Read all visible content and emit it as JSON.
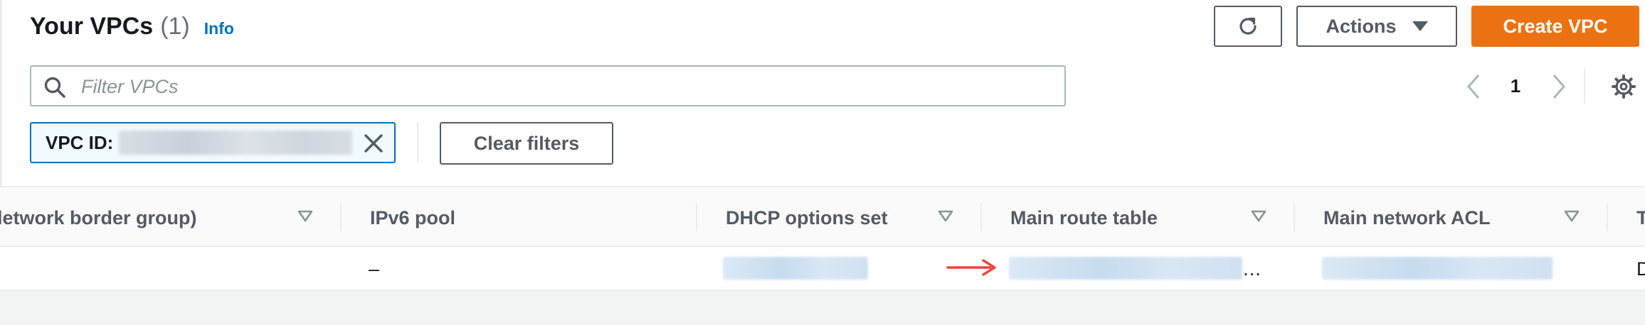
{
  "header": {
    "title": "Your VPCs",
    "count": "(1)",
    "info_link": "Info"
  },
  "toolbar": {
    "refresh_icon": "refresh-icon",
    "actions_label": "Actions",
    "create_label": "Create VPC"
  },
  "search": {
    "placeholder": "Filter VPCs",
    "value": ""
  },
  "filter_token": {
    "label": "VPC ID:",
    "clear_label": "Clear filters"
  },
  "pagination": {
    "current_page": "1"
  },
  "table": {
    "columns": [
      "letwork border group)",
      "IPv6 pool",
      "DHCP options set",
      "Main route table",
      "Main network ACL",
      "T"
    ],
    "rows": [
      {
        "ipv6_pool": "–",
        "route_table_ellipsis": "…",
        "last_col": "D"
      }
    ]
  },
  "colors": {
    "primary": "#ec7211",
    "link": "#0073bb",
    "annotation_arrow": "#e8453c"
  }
}
